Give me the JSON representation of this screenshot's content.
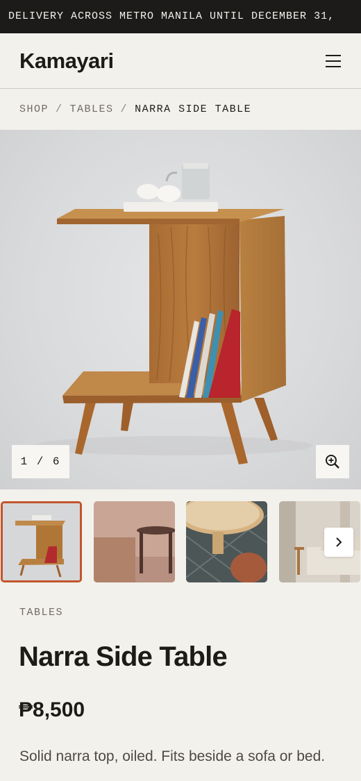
{
  "announcement": "DELIVERY ACROSS METRO MANILA UNTIL DECEMBER 31,",
  "header": {
    "logo": "Kamayari",
    "menu_icon": "hamburger-menu-icon"
  },
  "breadcrumb": {
    "items": [
      "SHOP",
      "TABLES"
    ],
    "separator": "/",
    "current": "NARRA SIDE TABLE"
  },
  "gallery": {
    "counter": "1 / 6",
    "zoom_icon": "zoom-in-icon",
    "thumbnails": [
      "narra side table",
      "stool and round table",
      "round table top",
      "sofa with side table"
    ],
    "next_icon": "chevron-right-icon"
  },
  "product": {
    "category": "TABLES",
    "name": "Narra Side Table",
    "price": "₱8,500",
    "description": "Solid narra top, oiled. Fits beside a sofa or bed."
  },
  "colors": {
    "accent": "#c2552b",
    "ink": "#1d1b18",
    "background": "#f3f1ec"
  }
}
